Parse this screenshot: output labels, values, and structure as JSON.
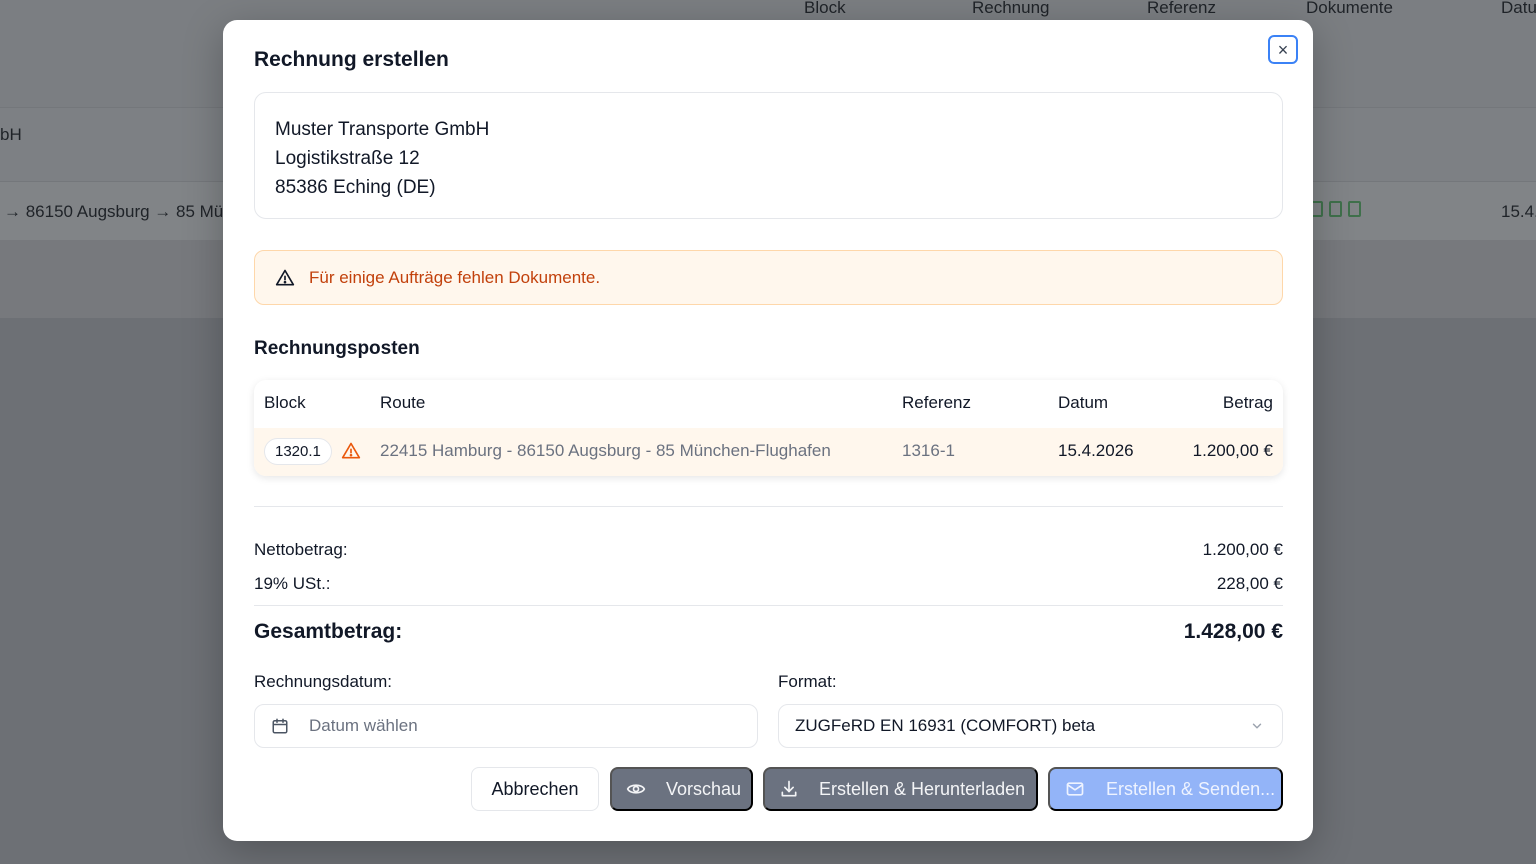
{
  "background": {
    "columns": [
      "Block",
      "Rechnung",
      "Referenz",
      "Dokumente",
      "Datu"
    ],
    "row_company_fragment": "bH",
    "row_route_fragment": "→ 86150 Augsburg → 85 Mü",
    "row_date_fragment": "15.4."
  },
  "modal": {
    "title": "Rechnung erstellen",
    "close_label": "×",
    "address": {
      "company": "Muster Transporte GmbH",
      "street": "Logistikstraße 12",
      "city": "85386 Eching (DE)"
    },
    "alert": {
      "text": "Für einige Aufträge fehlen Dokumente.",
      "color": "#c2410c"
    },
    "items_title": "Rechnungsposten",
    "table": {
      "headers": {
        "block": "Block",
        "route": "Route",
        "reference": "Referenz",
        "date": "Datum",
        "amount": "Betrag"
      },
      "rows": [
        {
          "block": "1320.1",
          "route": "22415 Hamburg - 86150 Augsburg - 85 München-Flughafen",
          "reference": "1316-1",
          "date": "15.4.2026",
          "amount": "1.200,00 €",
          "warning_icon": "warning-triangle-icon"
        }
      ]
    },
    "summary": {
      "net_label": "Nettobetrag:",
      "net_value": "1.200,00 €",
      "vat_label": "19% USt.:",
      "vat_value": "228,00 €",
      "total_label": "Gesamtbetrag:",
      "total_value": "1.428,00 €"
    },
    "invoice_date": {
      "label": "Rechnungsdatum:",
      "placeholder": "Datum wählen"
    },
    "format": {
      "label": "Format:",
      "selected": "ZUGFeRD EN 16931 (COMFORT) beta"
    },
    "buttons": {
      "cancel": "Abbrechen",
      "preview": "Vorschau",
      "create_download": "Erstellen & Herunterladen",
      "create_send": "Erstellen & Senden..."
    },
    "colors": {
      "accent": "#3b82f6",
      "send_button": "#93b4f8",
      "secondary_button": "#6b7280",
      "alert_bg": "#fff7ed"
    }
  }
}
